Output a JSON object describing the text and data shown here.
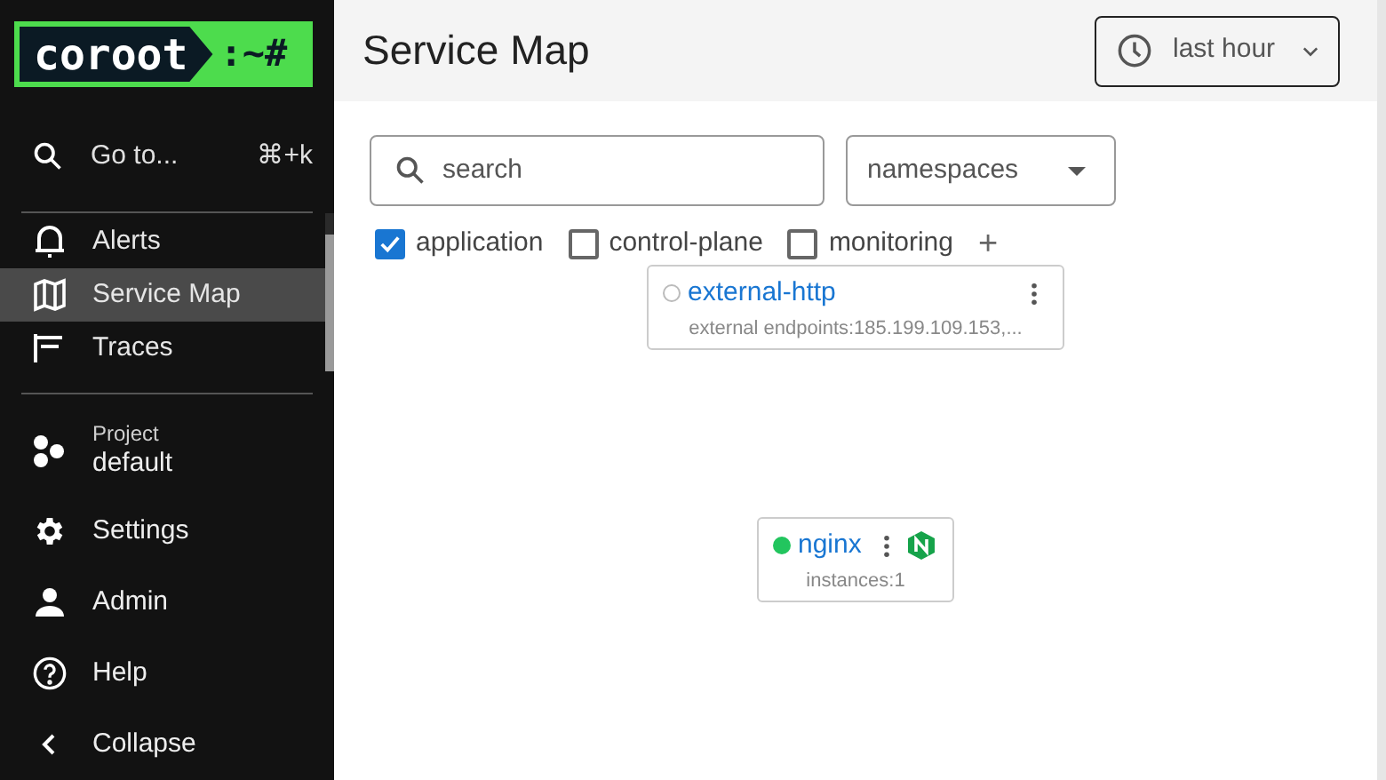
{
  "logo": {
    "word": "coroot",
    "prompt": ":~#"
  },
  "goto": {
    "label": "Go to...",
    "shortcut": "⌘+k"
  },
  "nav": [
    {
      "label": "Alerts",
      "kind": "alert",
      "selected": false
    },
    {
      "label": "Service Map",
      "kind": "map",
      "selected": true
    },
    {
      "label": "Traces",
      "kind": "traces",
      "selected": false
    }
  ],
  "project": {
    "caption": "Project",
    "name": "default"
  },
  "bottom_nav": [
    {
      "label": "Settings",
      "kind": "gear"
    },
    {
      "label": "Admin",
      "kind": "person"
    },
    {
      "label": "Help",
      "kind": "help"
    },
    {
      "label": "Collapse",
      "kind": "chevron"
    }
  ],
  "page_title": "Service Map",
  "time_range": "last hour",
  "search": {
    "placeholder": "search"
  },
  "namespaces": {
    "placeholder": "namespaces"
  },
  "filters": [
    {
      "label": "application",
      "checked": true
    },
    {
      "label": "control-plane",
      "checked": false
    },
    {
      "label": "monitoring",
      "checked": false
    }
  ],
  "add_filter": "+",
  "nodes": [
    {
      "name": "external-http",
      "details": "external endpoints:185.199.109.153,...",
      "has_nginx_badge": false
    },
    {
      "name": "nginx",
      "details": "instances:1",
      "color": "#22c55e",
      "has_nginx_badge": true
    }
  ]
}
